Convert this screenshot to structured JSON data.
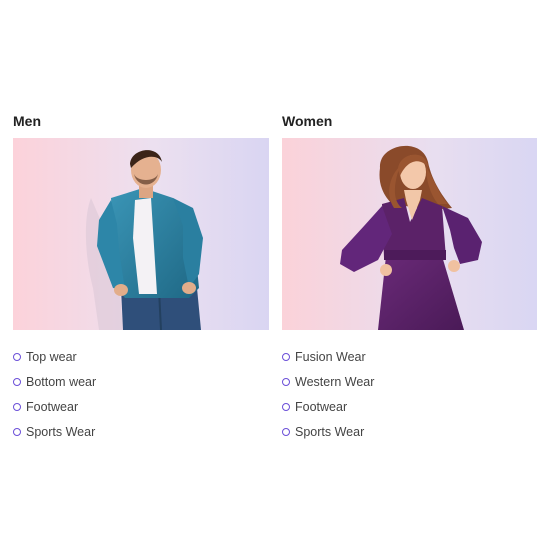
{
  "sections": [
    {
      "title": "Men",
      "image_alt": "man-in-denim-shirt",
      "items": [
        "Top wear",
        "Bottom wear",
        "Footwear",
        "Sports Wear"
      ]
    },
    {
      "title": "Women",
      "image_alt": "woman-in-purple-dress",
      "items": [
        "Fusion Wear",
        "Western Wear",
        "Footwear",
        "Sports Wear"
      ]
    }
  ],
  "colors": {
    "bullet": "#6b4fd8",
    "hero_bg_left": "#fcd3dc",
    "hero_bg_right": "#dcd6f2",
    "denim": "#2c7d9e",
    "dress": "#5a2266"
  }
}
